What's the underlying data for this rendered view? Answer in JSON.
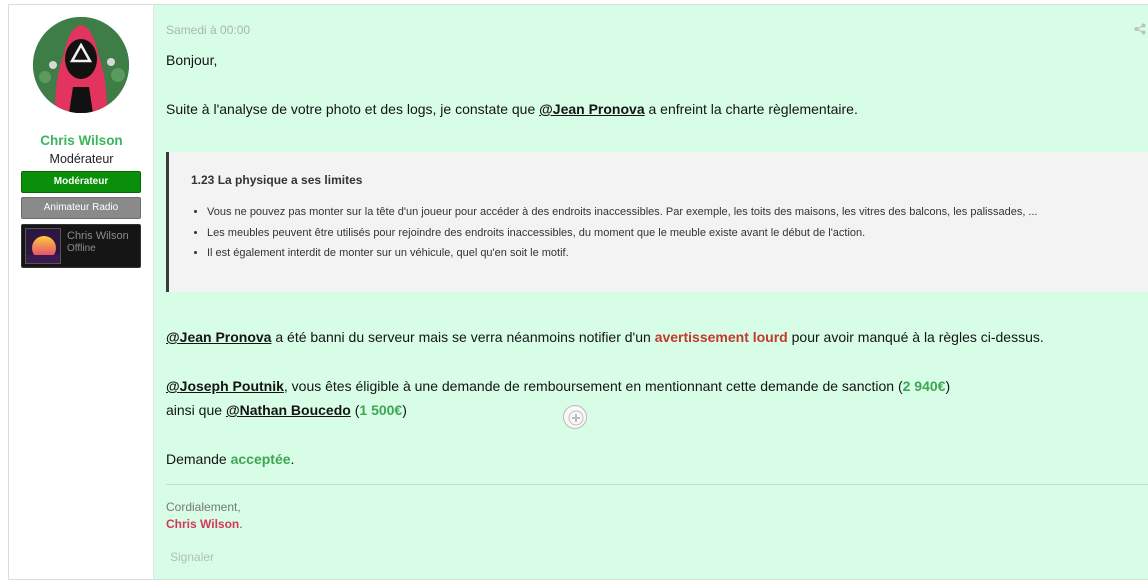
{
  "user": {
    "name": "Chris Wilson",
    "title": "Modérateur",
    "banners": [
      "Modérateur",
      "Animateur Radio"
    ],
    "status_card": {
      "name": "Chris Wilson",
      "state": "Offline"
    }
  },
  "post": {
    "date": "Samedi à 00:00",
    "greeting": "Bonjour,",
    "line1": {
      "before": "Suite à l'analyse de votre photo et des logs, je constate que ",
      "mention": "@Jean Pronova",
      "after": " a enfreint la charte règlementaire."
    },
    "quote": {
      "title": "1.23 La physique a ses limites",
      "items": [
        "Vous ne pouvez pas monter sur la tête d'un joueur pour accéder à des endroits inaccessibles. Par exemple, les toits des maisons, les vitres des balcons, les palissades, ...",
        "Les meubles peuvent être utilisés pour rejoindre des endroits inaccessibles, du moment que le meuble existe avant le début de l'action.",
        "Il est également interdit de monter sur un véhicule, quel qu'en soit le motif."
      ]
    },
    "line2": {
      "mention": "@Jean Pronova",
      "middle": " a été banni du serveur mais se verra néanmoins notifier d'un ",
      "highlight": "avertissement lourd",
      "after": " pour avoir manqué à la règles ci-dessus."
    },
    "line3": {
      "mention": "@Joseph Poutnik",
      "middle": ", vous êtes éligible à une demande de remboursement en mentionnant cette demande de sanction (",
      "amount": "2 940€",
      "after": ")"
    },
    "line4": {
      "before": "ainsi que ",
      "mention": "@Nathan Boucedo",
      "middle": " (",
      "amount": "1 500€",
      "after": ")"
    },
    "line5": {
      "before": "Demande ",
      "highlight": "acceptée",
      "after": "."
    },
    "regards": "Cordialement,",
    "signature": "Chris Wilson",
    "signature_dot": ".",
    "report": "Signaler"
  },
  "colors": {
    "post_bg": "#d7fde6",
    "name_green": "#3cb55a",
    "warning_red": "#c0392b",
    "amount_green": "#3ea653",
    "signature_pink": "#d6365a"
  }
}
